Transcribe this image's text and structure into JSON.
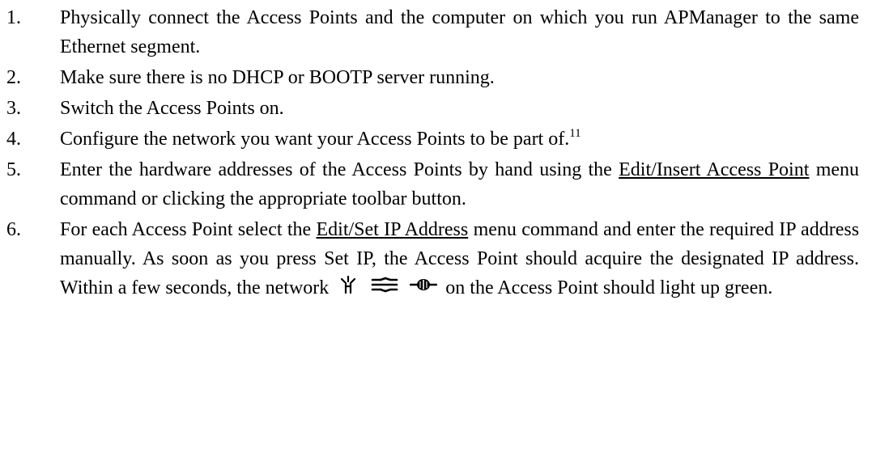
{
  "steps": [
    {
      "number": "1.",
      "text": "Physically connect the Access Points and the computer on which you run APManager to the same Ethernet segment."
    },
    {
      "number": "2.",
      "text": "Make sure there is no DHCP or BOOTP server running."
    },
    {
      "number": "3.",
      "text": "Switch the Access Points on."
    },
    {
      "number": "4.",
      "text": "Configure the network you want your Access Points to be part of.",
      "footnote": "11"
    },
    {
      "number": "5.",
      "text_before": "Enter the hardware addresses of the Access Points by hand using the",
      "link": "Edit/Insert Access Point",
      "text_after": "menu command or clicking the appropriate toolbar button."
    },
    {
      "number": "6.",
      "text_before": "For each Access Point select the",
      "link": "Edit/Set IP Address",
      "text_middle": "menu command and enter the required IP address manually. As soon as you press Set IP, the Access Point should acquire the designated IP address. Within a few seconds, the network",
      "icons": [
        "network-activity-icon",
        "network-lines-icon",
        "network-connector-icon"
      ],
      "text_after": "on the Access Point should light up green."
    }
  ]
}
